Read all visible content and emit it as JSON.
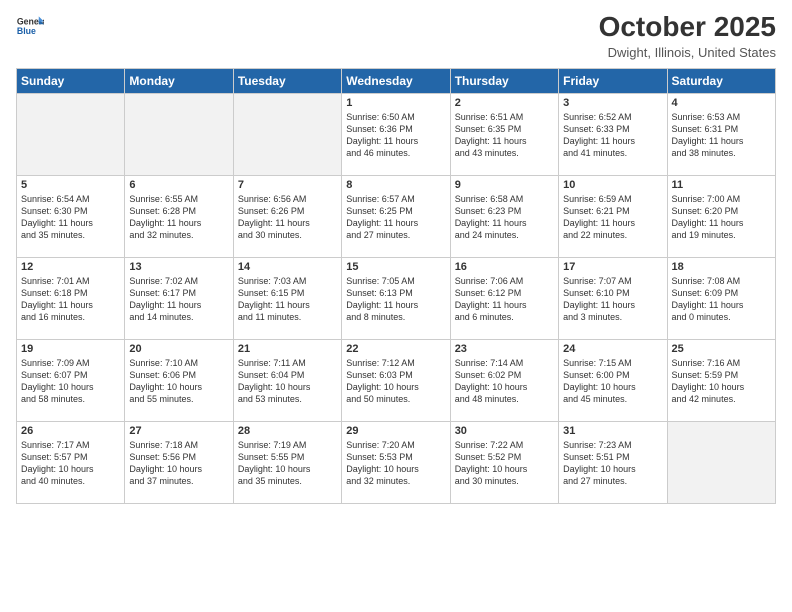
{
  "header": {
    "logo_line1": "General",
    "logo_line2": "Blue",
    "month_title": "October 2025",
    "location": "Dwight, Illinois, United States"
  },
  "weekdays": [
    "Sunday",
    "Monday",
    "Tuesday",
    "Wednesday",
    "Thursday",
    "Friday",
    "Saturday"
  ],
  "weeks": [
    [
      {
        "day": "",
        "info": ""
      },
      {
        "day": "",
        "info": ""
      },
      {
        "day": "",
        "info": ""
      },
      {
        "day": "1",
        "info": "Sunrise: 6:50 AM\nSunset: 6:36 PM\nDaylight: 11 hours\nand 46 minutes."
      },
      {
        "day": "2",
        "info": "Sunrise: 6:51 AM\nSunset: 6:35 PM\nDaylight: 11 hours\nand 43 minutes."
      },
      {
        "day": "3",
        "info": "Sunrise: 6:52 AM\nSunset: 6:33 PM\nDaylight: 11 hours\nand 41 minutes."
      },
      {
        "day": "4",
        "info": "Sunrise: 6:53 AM\nSunset: 6:31 PM\nDaylight: 11 hours\nand 38 minutes."
      }
    ],
    [
      {
        "day": "5",
        "info": "Sunrise: 6:54 AM\nSunset: 6:30 PM\nDaylight: 11 hours\nand 35 minutes."
      },
      {
        "day": "6",
        "info": "Sunrise: 6:55 AM\nSunset: 6:28 PM\nDaylight: 11 hours\nand 32 minutes."
      },
      {
        "day": "7",
        "info": "Sunrise: 6:56 AM\nSunset: 6:26 PM\nDaylight: 11 hours\nand 30 minutes."
      },
      {
        "day": "8",
        "info": "Sunrise: 6:57 AM\nSunset: 6:25 PM\nDaylight: 11 hours\nand 27 minutes."
      },
      {
        "day": "9",
        "info": "Sunrise: 6:58 AM\nSunset: 6:23 PM\nDaylight: 11 hours\nand 24 minutes."
      },
      {
        "day": "10",
        "info": "Sunrise: 6:59 AM\nSunset: 6:21 PM\nDaylight: 11 hours\nand 22 minutes."
      },
      {
        "day": "11",
        "info": "Sunrise: 7:00 AM\nSunset: 6:20 PM\nDaylight: 11 hours\nand 19 minutes."
      }
    ],
    [
      {
        "day": "12",
        "info": "Sunrise: 7:01 AM\nSunset: 6:18 PM\nDaylight: 11 hours\nand 16 minutes."
      },
      {
        "day": "13",
        "info": "Sunrise: 7:02 AM\nSunset: 6:17 PM\nDaylight: 11 hours\nand 14 minutes."
      },
      {
        "day": "14",
        "info": "Sunrise: 7:03 AM\nSunset: 6:15 PM\nDaylight: 11 hours\nand 11 minutes."
      },
      {
        "day": "15",
        "info": "Sunrise: 7:05 AM\nSunset: 6:13 PM\nDaylight: 11 hours\nand 8 minutes."
      },
      {
        "day": "16",
        "info": "Sunrise: 7:06 AM\nSunset: 6:12 PM\nDaylight: 11 hours\nand 6 minutes."
      },
      {
        "day": "17",
        "info": "Sunrise: 7:07 AM\nSunset: 6:10 PM\nDaylight: 11 hours\nand 3 minutes."
      },
      {
        "day": "18",
        "info": "Sunrise: 7:08 AM\nSunset: 6:09 PM\nDaylight: 11 hours\nand 0 minutes."
      }
    ],
    [
      {
        "day": "19",
        "info": "Sunrise: 7:09 AM\nSunset: 6:07 PM\nDaylight: 10 hours\nand 58 minutes."
      },
      {
        "day": "20",
        "info": "Sunrise: 7:10 AM\nSunset: 6:06 PM\nDaylight: 10 hours\nand 55 minutes."
      },
      {
        "day": "21",
        "info": "Sunrise: 7:11 AM\nSunset: 6:04 PM\nDaylight: 10 hours\nand 53 minutes."
      },
      {
        "day": "22",
        "info": "Sunrise: 7:12 AM\nSunset: 6:03 PM\nDaylight: 10 hours\nand 50 minutes."
      },
      {
        "day": "23",
        "info": "Sunrise: 7:14 AM\nSunset: 6:02 PM\nDaylight: 10 hours\nand 48 minutes."
      },
      {
        "day": "24",
        "info": "Sunrise: 7:15 AM\nSunset: 6:00 PM\nDaylight: 10 hours\nand 45 minutes."
      },
      {
        "day": "25",
        "info": "Sunrise: 7:16 AM\nSunset: 5:59 PM\nDaylight: 10 hours\nand 42 minutes."
      }
    ],
    [
      {
        "day": "26",
        "info": "Sunrise: 7:17 AM\nSunset: 5:57 PM\nDaylight: 10 hours\nand 40 minutes."
      },
      {
        "day": "27",
        "info": "Sunrise: 7:18 AM\nSunset: 5:56 PM\nDaylight: 10 hours\nand 37 minutes."
      },
      {
        "day": "28",
        "info": "Sunrise: 7:19 AM\nSunset: 5:55 PM\nDaylight: 10 hours\nand 35 minutes."
      },
      {
        "day": "29",
        "info": "Sunrise: 7:20 AM\nSunset: 5:53 PM\nDaylight: 10 hours\nand 32 minutes."
      },
      {
        "day": "30",
        "info": "Sunrise: 7:22 AM\nSunset: 5:52 PM\nDaylight: 10 hours\nand 30 minutes."
      },
      {
        "day": "31",
        "info": "Sunrise: 7:23 AM\nSunset: 5:51 PM\nDaylight: 10 hours\nand 27 minutes."
      },
      {
        "day": "",
        "info": ""
      }
    ]
  ]
}
